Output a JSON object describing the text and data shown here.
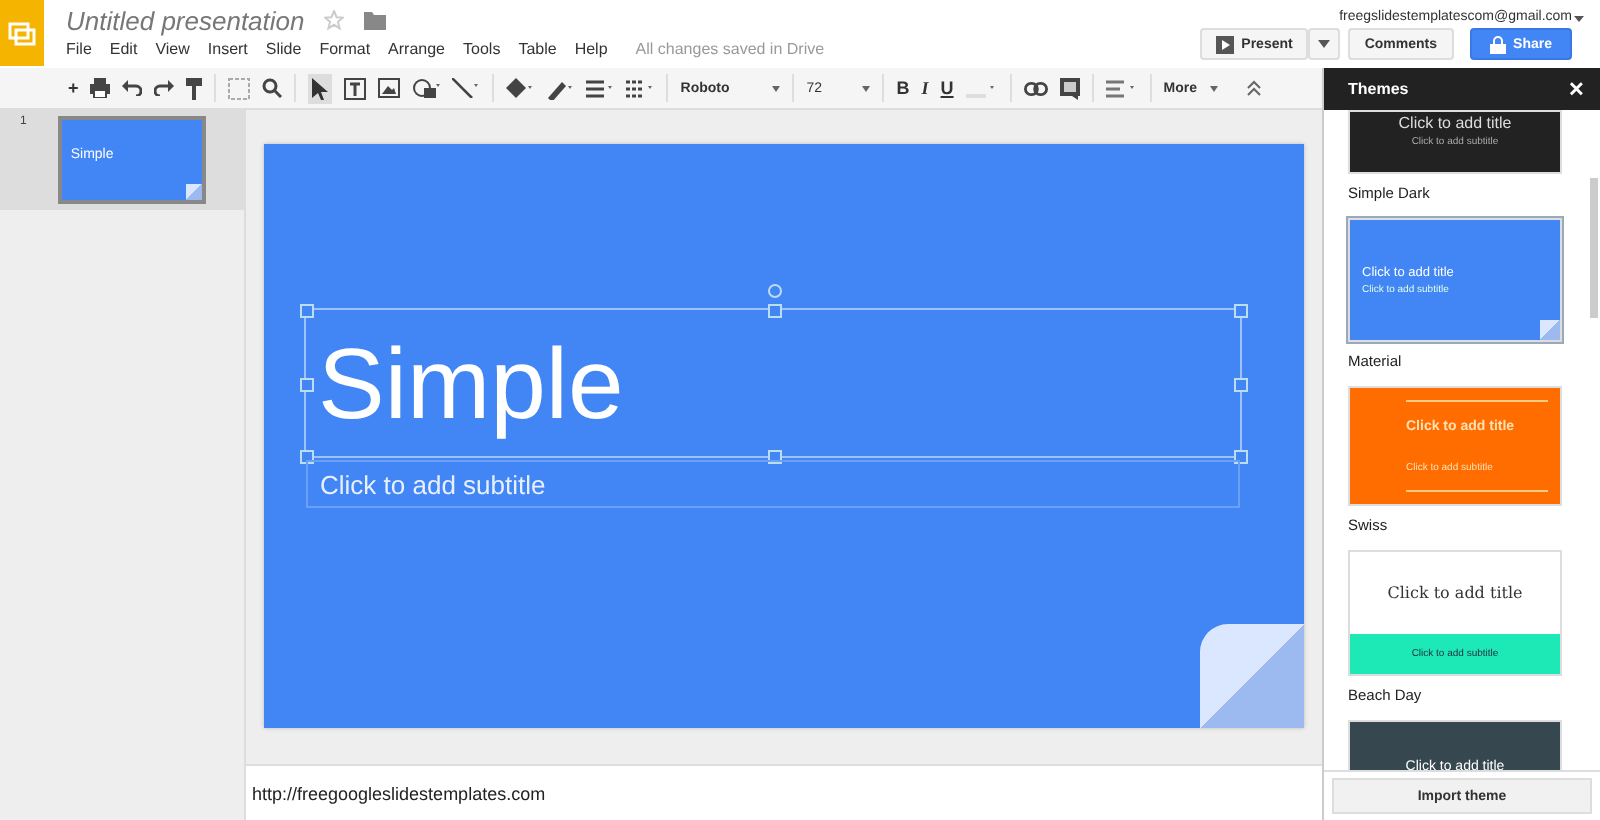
{
  "document": {
    "title": "Untitled presentation",
    "save_status": "All changes saved in Drive"
  },
  "menu": [
    "File",
    "Edit",
    "View",
    "Insert",
    "Slide",
    "Format",
    "Arrange",
    "Tools",
    "Table",
    "Help"
  ],
  "account": "freegslidestemplatescom@gmail.com",
  "buttons": {
    "present": "Present",
    "comments": "Comments",
    "share": "Share"
  },
  "toolbar": {
    "new_slide": "+",
    "font": "Roboto",
    "size": "72",
    "bold": "B",
    "italic": "I",
    "underline": "U",
    "more": "More"
  },
  "slides": [
    {
      "number": "1",
      "title": "Simple",
      "selected": true
    }
  ],
  "slide": {
    "title": "Simple",
    "subtitle": "Click to add subtitle",
    "title_selected": true
  },
  "notes": "http://freegoogleslidestemplates.com",
  "themes_panel": {
    "title": "Themes",
    "close": "✕",
    "import": "Import theme",
    "themes": [
      {
        "kind": "dark",
        "name": "Simple Dark",
        "title": "Click to add title",
        "subtitle": "Click to add subtitle",
        "selected": false
      },
      {
        "kind": "material",
        "name": "Material",
        "title": "Click to add title",
        "subtitle": "Click to add subtitle",
        "selected": true
      },
      {
        "kind": "swiss",
        "name": "Swiss",
        "title": "Click to add title",
        "subtitle": "Click to add subtitle",
        "selected": false
      },
      {
        "kind": "beach",
        "name": "Beach Day",
        "title": "Click to add title",
        "subtitle": "Click to add subtitle",
        "selected": false
      },
      {
        "kind": "slate",
        "title": "Click to add title",
        "selected": false
      }
    ]
  }
}
